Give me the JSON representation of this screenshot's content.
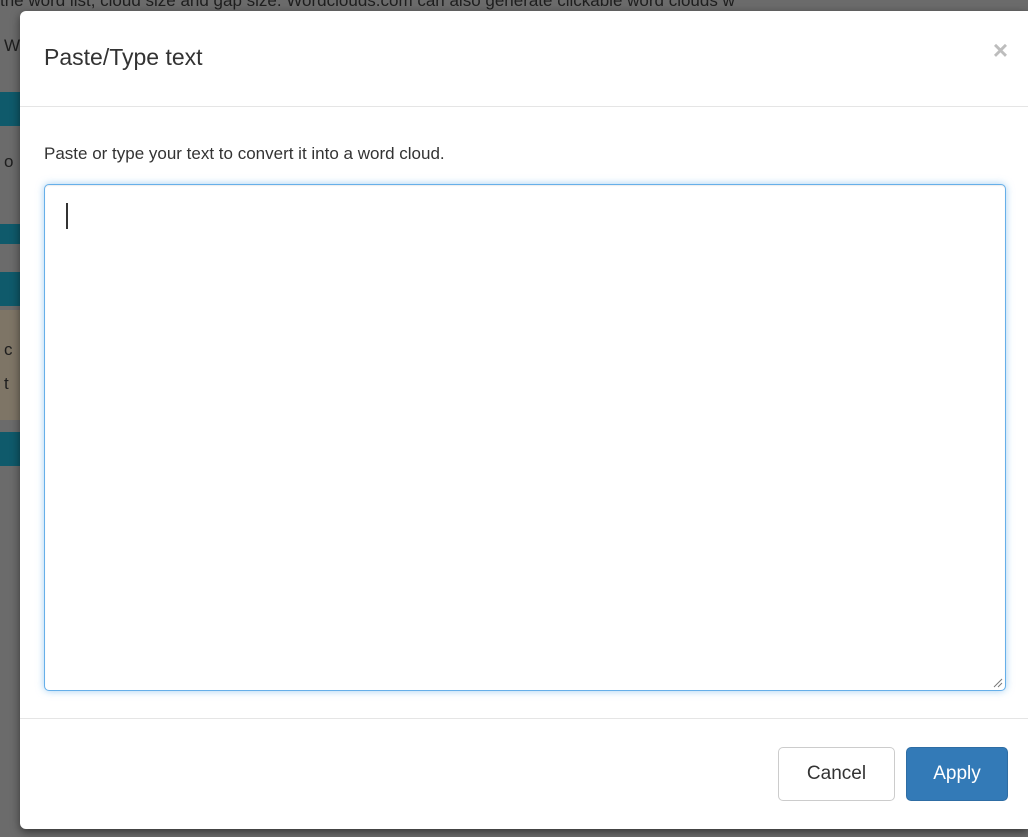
{
  "background": {
    "text_fragment": "the word list, cloud size and gap size. Wordclouds.com can also generate clickable word clouds w",
    "edge_chars": [
      "W",
      "o",
      "c",
      "t"
    ]
  },
  "modal": {
    "title": "Paste/Type text",
    "close_label": "×",
    "instruction": "Paste or type your text to convert it into a word cloud.",
    "textarea_value": "",
    "cancel_label": "Cancel",
    "apply_label": "Apply"
  },
  "colors": {
    "primary": "#337ab7",
    "focus_border": "#66afe9"
  }
}
